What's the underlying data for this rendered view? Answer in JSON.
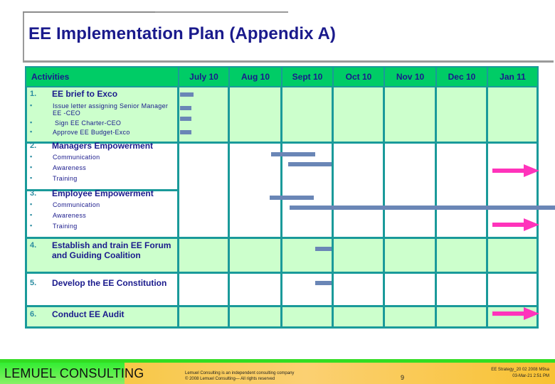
{
  "slide": {
    "title": "EE Implementation Plan (Appendix A)"
  },
  "table": {
    "header": {
      "activities_label": "Activities",
      "months": [
        "July 10",
        "Aug 10",
        "Sept 10",
        "Oct 10",
        "Nov 10",
        "Dec 10",
        "Jan 11"
      ]
    },
    "rows": [
      {
        "number": "1.",
        "title": "EE brief to Exco",
        "subitems": [
          "Issue letter assigning Senior Manager EE -CEO",
          "Sign EE Charter-CEO",
          "Approve EE Budget-Exco"
        ]
      },
      {
        "number": "2.",
        "title": "Managers Empowerment",
        "subitems": [
          "Communication",
          "Awareness",
          "Training"
        ]
      },
      {
        "number": "3.",
        "title": "Employee Empowerment",
        "subitems": [
          "Communication",
          "Awareness",
          "Training"
        ]
      },
      {
        "number": "4.",
        "title": "Establish and train EE Forum and Guiding Coalition",
        "subitems": []
      },
      {
        "number": "5.",
        "title": "Develop the EE Constitution",
        "subitems": []
      },
      {
        "number": "6.",
        "title": "Conduct  EE Audit",
        "subitems": []
      }
    ]
  },
  "colors": {
    "header_bg": "#00cc66",
    "row_green": "#ccffcc",
    "grid_line": "#1a9a9a",
    "bar": "#6a86b6",
    "arrow": "#ff33bb",
    "title_text": "#1a1a8c"
  },
  "footer": {
    "brand": "LEMUEL CONSULTING",
    "tagline": "Lemuel Consulting is an independent consulting company",
    "copyright": "© 2008 Lemuel Consulting— All rights reserved",
    "slide_number": "9",
    "file_info": "EE Strategy_20 02 2008 M9sa",
    "date_info": "03-Mar-21  2:51 PM"
  }
}
